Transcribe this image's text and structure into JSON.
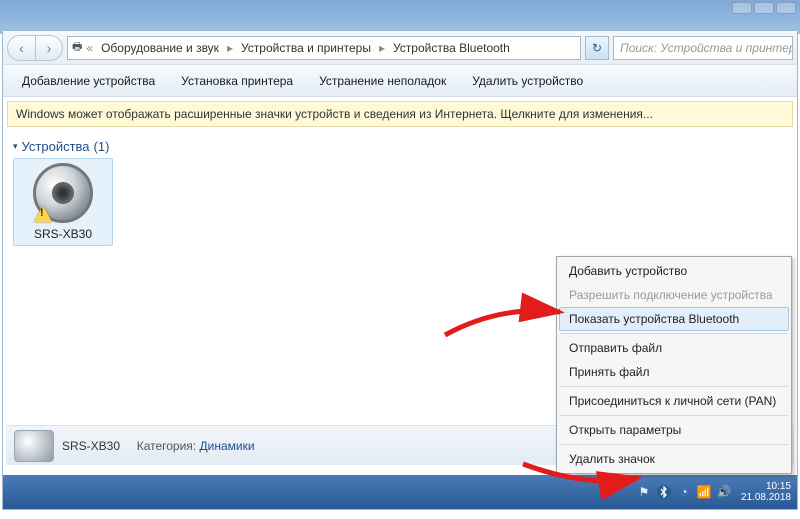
{
  "breadcrumbs": {
    "root_icon": "devices-icon",
    "items": [
      "Оборудование и звук",
      "Устройства и принтеры",
      "Устройства Bluetooth"
    ]
  },
  "search": {
    "placeholder": "Поиск: Устройства и принтеры"
  },
  "toolbar": {
    "add_device": "Добавление устройства",
    "add_printer": "Установка принтера",
    "troubleshoot": "Устранение неполадок",
    "remove_device": "Удалить устройство"
  },
  "infobar": {
    "text": "Windows может отображать расширенные значки устройств и сведения из Интернета.   Щелкните для изменения..."
  },
  "group": {
    "title": "Устройства",
    "count": "(1)"
  },
  "device": {
    "name": "SRS-XB30"
  },
  "details": {
    "name": "SRS-XB30",
    "category_label": "Категория:",
    "category_value": "Динамики"
  },
  "context_menu": {
    "add": "Добавить устройство",
    "allow": "Разрешить подключение устройства",
    "show_bt": "Показать устройства Bluetooth",
    "send": "Отправить файл",
    "receive": "Принять файл",
    "pan": "Присоединиться к личной сети (PAN)",
    "params": "Открыть параметры",
    "remove_icon": "Удалить значок"
  },
  "tray": {
    "time": "10:15",
    "date": "21.08.2018"
  },
  "icons": {
    "back": "‹",
    "fwd": "›",
    "refresh": "↻",
    "flag": "⚑",
    "bt": "ᚼ",
    "net": "◷",
    "vol": "🔊",
    "sig": "▮"
  }
}
